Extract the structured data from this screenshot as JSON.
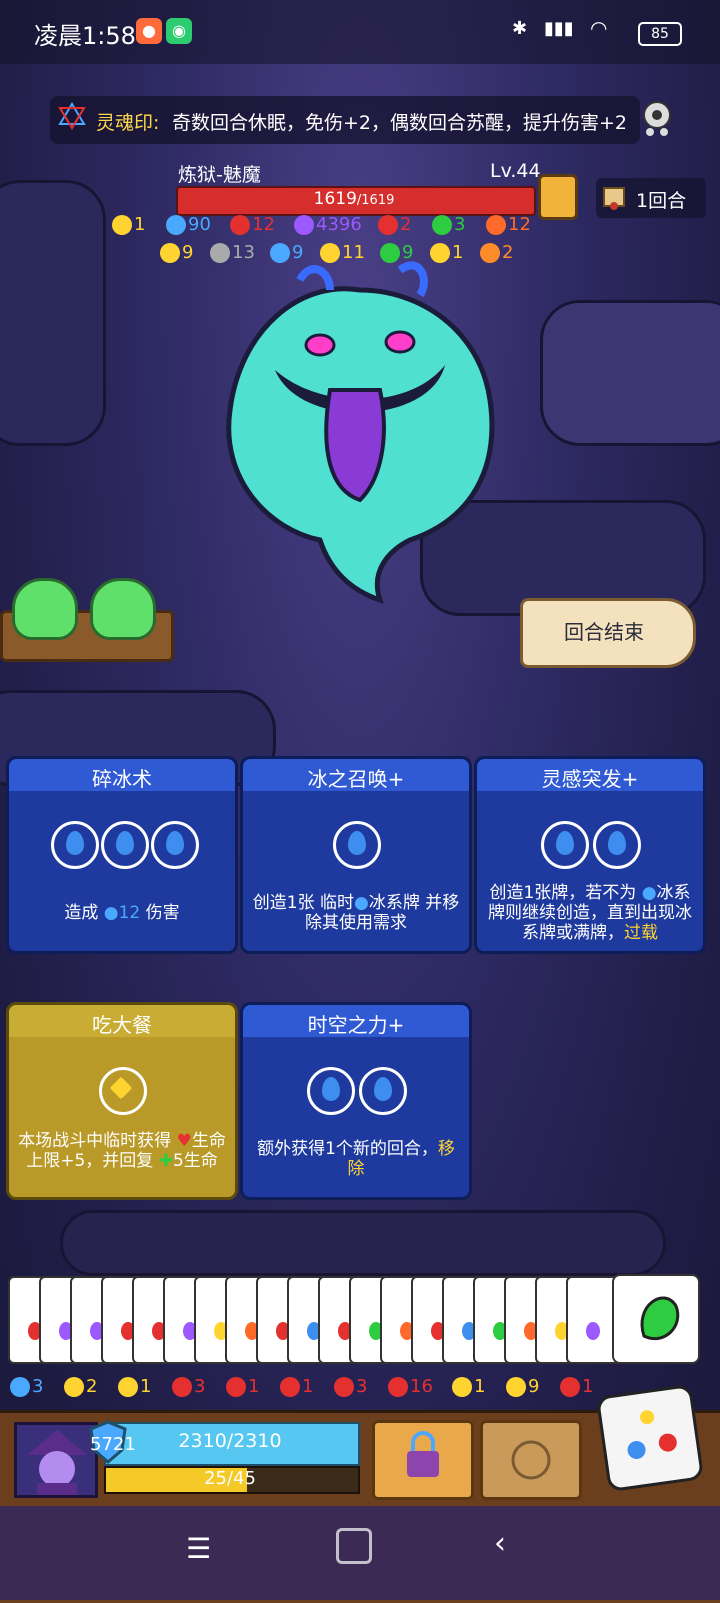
{
  "status_bar": {
    "time": "凌晨1:58",
    "battery": "85"
  },
  "soul_seal": {
    "title": "灵魂印:",
    "text": "奇数回合休眠，免伤+2，偶数回合苏醒，提升伤害+2"
  },
  "enemy": {
    "name": "炼狱-魅魔",
    "level": "Lv.44",
    "hp": "1619",
    "hp_max": "/1619",
    "stats_row1": [
      {
        "icon": "spark-icon",
        "value": "1",
        "color": "#ffd430"
      },
      {
        "icon": "snowflake-icon",
        "value": "90",
        "color": "#4aa8ff"
      },
      {
        "icon": "blood-drop-icon",
        "value": "12",
        "color": "#e53030"
      },
      {
        "icon": "purple-burst-icon",
        "value": "4396",
        "color": "#9b59ff"
      },
      {
        "icon": "heart-shield-icon",
        "value": "2",
        "color": "#e53030"
      },
      {
        "icon": "green-swirl-icon",
        "value": "3",
        "color": "#2ecc40"
      },
      {
        "icon": "flame-icon",
        "value": "12",
        "color": "#ff6a2a"
      }
    ],
    "stats_row2": [
      {
        "icon": "triangle-icon",
        "value": "9",
        "color": "#ffd430"
      },
      {
        "icon": "skull-icon",
        "value": "13",
        "color": "#aaaaaa"
      },
      {
        "icon": "bubble-icon",
        "value": "9",
        "color": "#4aa8ff"
      },
      {
        "icon": "lock-icon",
        "value": "11",
        "color": "#ffd430"
      },
      {
        "icon": "vine-icon",
        "value": "9",
        "color": "#2ecc40"
      },
      {
        "icon": "claw-icon",
        "value": "1",
        "color": "#ffd430"
      },
      {
        "icon": "fire-icon",
        "value": "2",
        "color": "#ff8c2a"
      }
    ]
  },
  "turn": {
    "label": "1回合"
  },
  "end_turn": {
    "label": "回合结束"
  },
  "cards": [
    {
      "title": "碎冰术",
      "gems": 3,
      "gem_type": "water",
      "desc_pre": "造成 ",
      "desc_mid": "12",
      "desc_post": " 伤害",
      "desc_hl": ""
    },
    {
      "title": "冰之召唤+",
      "gems": 1,
      "gem_type": "water",
      "desc_pre": "创造1张 临时",
      "desc_mid": "",
      "desc_post": "冰系牌 并移除其使用需求",
      "desc_hl": ""
    },
    {
      "title": "灵感突发+",
      "gems": 2,
      "gem_type": "water",
      "desc_pre": "创造1张牌，若不为 ",
      "desc_mid": "",
      "desc_post": "冰系牌则继续创造，直到出现冰系牌或满牌，",
      "desc_hl": "过载"
    },
    {
      "title": "吃大餐",
      "gems": 1,
      "gem_type": "gold",
      "desc_pre": "本场战斗中临时获得 ",
      "desc_mid": "",
      "desc_post": "生命上限+5，并回复 ",
      "desc_hl": "",
      "desc_tail": "5生命"
    },
    {
      "title": "时空之力+",
      "gems": 2,
      "gem_type": "water",
      "desc_pre": "额外获得1个新的回合，",
      "desc_mid": "",
      "desc_post": "",
      "desc_hl": "移除"
    }
  ],
  "player_stats": [
    {
      "icon": "target-icon",
      "value": "3",
      "color": "#4aa8ff"
    },
    {
      "icon": "lightning-icon",
      "value": "2",
      "color": "#ffd430"
    },
    {
      "icon": "shield-icon",
      "value": "1",
      "color": "#ffd430"
    },
    {
      "icon": "heart-shield-icon",
      "value": "3",
      "color": "#e53030"
    },
    {
      "icon": "red-target-icon",
      "value": "1",
      "color": "#e53030"
    },
    {
      "icon": "red-shield-icon",
      "value": "1",
      "color": "#e53030"
    },
    {
      "icon": "red-splash-icon",
      "value": "3",
      "color": "#e53030"
    },
    {
      "icon": "red-spiral-icon",
      "value": "16",
      "color": "#e53030"
    },
    {
      "icon": "spark-icon",
      "value": "1",
      "color": "#ffd430"
    },
    {
      "icon": "gold-target-icon",
      "value": "9",
      "color": "#ffd430"
    },
    {
      "icon": "red-shield-icon",
      "value": "1",
      "color": "#e53030"
    }
  ],
  "player": {
    "shield": "5721",
    "hp": "2310/2310",
    "mana": "25/45",
    "mana_fraction": 0.56
  }
}
